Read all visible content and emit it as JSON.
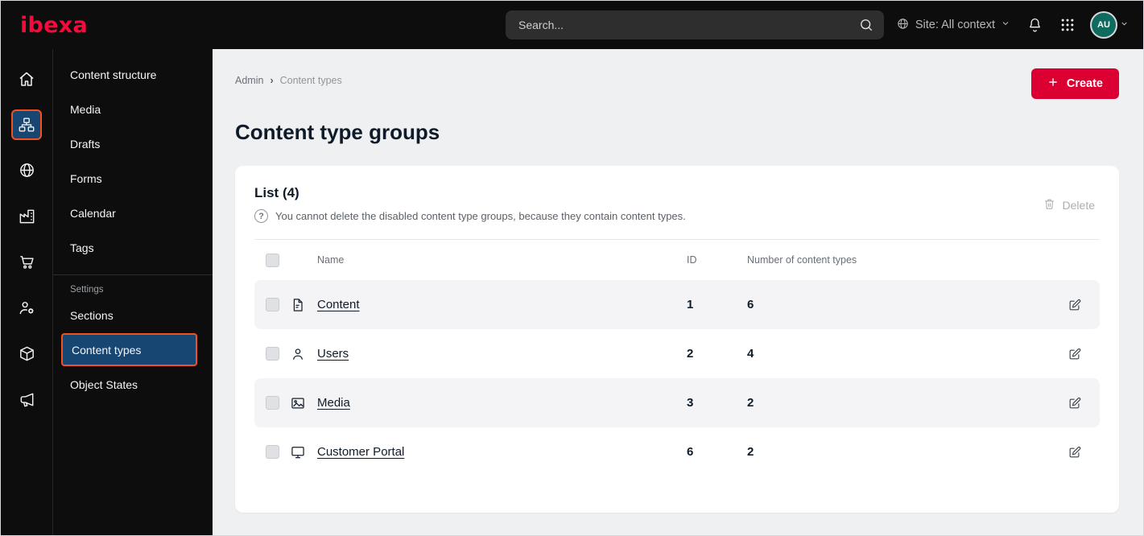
{
  "topbar": {
    "logo": "ibexa",
    "search_placeholder": "Search...",
    "site_context": "Site: All context",
    "avatar_initials": "AU",
    "icons": [
      "search-icon",
      "globe-icon",
      "chevron-down-icon",
      "bell-icon",
      "apps-grid-icon",
      "avatar"
    ]
  },
  "sidebar": {
    "rail_icons": [
      "home-icon",
      "content-structure-icon",
      "site-icon",
      "company-icon",
      "commerce-cart-icon",
      "customers-icon",
      "products-icon",
      "marketing-megaphone-icon"
    ],
    "active_rail_icon": "content-structure-icon",
    "menu_items": [
      "Content structure",
      "Media",
      "Drafts",
      "Forms",
      "Calendar",
      "Tags"
    ],
    "settings_label": "Settings",
    "settings_items": [
      "Sections",
      "Content types",
      "Object States"
    ],
    "active_item": "Content types"
  },
  "main": {
    "breadcrumb": {
      "items": [
        "Admin",
        "Content types"
      ],
      "separator": "›"
    },
    "create_button": "Create",
    "page_title": "Content type groups",
    "card": {
      "list_title": "List (4)",
      "help_glyph": "?",
      "note": "You cannot delete the disabled content type groups, because they contain content types.",
      "delete_button": "Delete",
      "table": {
        "headers": [
          "Name",
          "ID",
          "Number of content types"
        ],
        "rows": [
          {
            "icon": "content-file-icon",
            "name": "Content",
            "id": "1",
            "count": "6"
          },
          {
            "icon": "users-icon",
            "name": "Users",
            "id": "2",
            "count": "4"
          },
          {
            "icon": "media-image-icon",
            "name": "Media",
            "id": "3",
            "count": "2"
          },
          {
            "icon": "customer-portal-monitor-icon",
            "name": "Customer Portal",
            "id": "6",
            "count": "2"
          }
        ]
      }
    }
  },
  "colors": {
    "brand_red": "#DC0032",
    "highlight_orange": "#F4511E",
    "active_blue": "#174672",
    "topbar_bg": "#0D0D0D",
    "main_bg": "#EFF0F2",
    "stripe_bg": "#F4F4F6",
    "avatar_green": "#0E6B5D"
  }
}
